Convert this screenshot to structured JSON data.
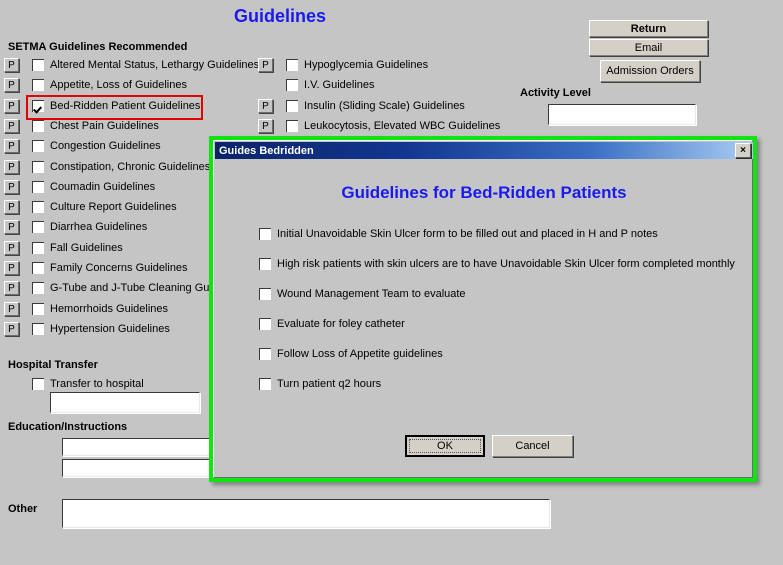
{
  "page": {
    "title": "Guidelines",
    "title_color": "#1a1aee",
    "background": "#c5c5c5"
  },
  "sections": {
    "recommended_label": "SETMA Guidelines Recommended",
    "hospital_transfer_label": "Hospital Transfer",
    "education_label": "Education/Instructions",
    "other_label": "Other",
    "activity_level_label": "Activity Level"
  },
  "guidelines_left": [
    {
      "p": "P",
      "has_p": true,
      "checked": false,
      "label": "Altered Mental Status, Lethargy Guidelines"
    },
    {
      "p": "P",
      "has_p": true,
      "checked": false,
      "label": "Appetite, Loss of Guidelines"
    },
    {
      "p": "P",
      "has_p": true,
      "checked": true,
      "label": "Bed-Ridden Patient Guidelines"
    },
    {
      "p": "P",
      "has_p": true,
      "checked": false,
      "label": "Chest Pain Guidelines"
    },
    {
      "p": "P",
      "has_p": true,
      "checked": false,
      "label": "Congestion Guidelines"
    },
    {
      "p": "P",
      "has_p": true,
      "checked": false,
      "label": "Constipation, Chronic Guidelines"
    },
    {
      "p": "P",
      "has_p": true,
      "checked": false,
      "label": "Coumadin Guidelines"
    },
    {
      "p": "P",
      "has_p": true,
      "checked": false,
      "label": "Culture Report Guidelines"
    },
    {
      "p": "P",
      "has_p": true,
      "checked": false,
      "label": "Diarrhea Guidelines"
    },
    {
      "p": "P",
      "has_p": true,
      "checked": false,
      "label": "Fall Guidelines"
    },
    {
      "p": "P",
      "has_p": true,
      "checked": false,
      "label": "Family Concerns Guidelines"
    },
    {
      "p": "P",
      "has_p": true,
      "checked": false,
      "label": "G-Tube and J-Tube Cleaning Guidelines"
    },
    {
      "p": "P",
      "has_p": true,
      "checked": false,
      "label": "Hemorrhoids Guidelines"
    },
    {
      "p": "P",
      "has_p": true,
      "checked": false,
      "label": "Hypertension Guidelines"
    }
  ],
  "guidelines_right": [
    {
      "p": "P",
      "has_p": true,
      "checked": false,
      "label": "Hypoglycemia Guidelines"
    },
    {
      "p": "P",
      "has_p": false,
      "checked": false,
      "label": "I.V. Guidelines"
    },
    {
      "p": "P",
      "has_p": true,
      "checked": false,
      "label": "Insulin (Sliding Scale) Guidelines"
    },
    {
      "p": "P",
      "has_p": true,
      "checked": false,
      "label": "Leukocytosis, Elevated WBC Guidelines"
    }
  ],
  "highlight": {
    "color": "#e30000",
    "target_label": "Bed-Ridden Patient Guidelines"
  },
  "toolbar": {
    "return_label": "Return",
    "email_label": "Email",
    "admission_orders_label": "Admission Orders"
  },
  "fields": {
    "activity_level_value": "",
    "transfer_checkbox_label": "Transfer to hospital",
    "transfer_checked": false,
    "transfer_value": "",
    "education_line1": "",
    "education_line2": "",
    "other_value": ""
  },
  "dialog": {
    "titlebar": "Guides Bedridden",
    "close_glyph": "×",
    "heading": "Guidelines for Bed-Ridden Patients",
    "heading_color": "#1a1aee",
    "border_color": "#12e312",
    "items": [
      {
        "checked": false,
        "label": "Initial Unavoidable Skin Ulcer form to be filled out and placed in H and P notes"
      },
      {
        "checked": false,
        "label": "High risk patients with skin ulcers are to have Unavoidable Skin Ulcer form completed monthly"
      },
      {
        "checked": false,
        "label": "Wound Management Team to evaluate"
      },
      {
        "checked": false,
        "label": "Evaluate for foley catheter"
      },
      {
        "checked": false,
        "label": "Follow Loss of Appetite guidelines"
      },
      {
        "checked": false,
        "label": "Turn patient q2 hours"
      }
    ],
    "ok_label": "OK",
    "cancel_label": "Cancel"
  }
}
